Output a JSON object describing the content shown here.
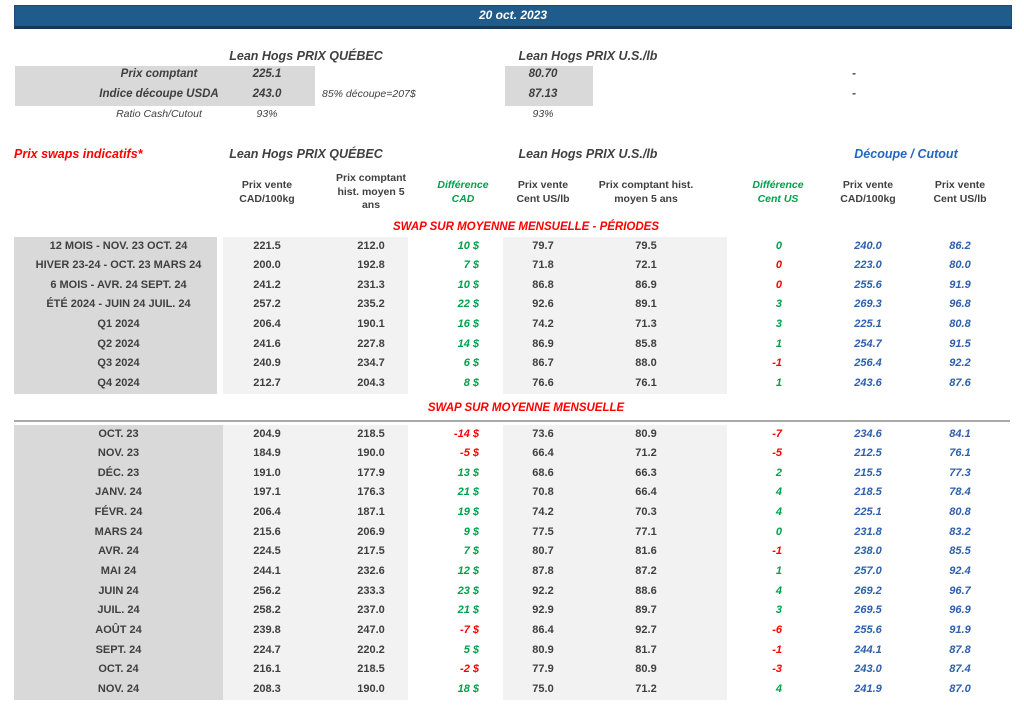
{
  "banner": {
    "date": "20 oct. 2023"
  },
  "colors": {
    "banner_bg": "#1F5C8C",
    "green": "#00A14B",
    "red": "#FF0000",
    "blue_values": "#2E5FAC",
    "label_bg": "#D9D9D9",
    "value_bg": "#F2F2F2"
  },
  "spot": {
    "qc_title": "Lean Hogs PRIX QUÉBEC",
    "us_title": "Lean Hogs PRIX U.S./lb",
    "rows": [
      {
        "label": "Prix comptant",
        "qc": "225.1",
        "note": "",
        "us": "80.70",
        "dash": "-"
      },
      {
        "label": "Indice découpe USDA",
        "qc": "243.0",
        "note": "85% découpe=207$",
        "us": "87.13",
        "dash": "-"
      },
      {
        "label": "Ratio Cash/Cutout",
        "qc": "93%",
        "note": "",
        "us": "93%",
        "dash": ""
      }
    ]
  },
  "swaps": {
    "title": "Prix swaps indicatifs*",
    "qc_title": "Lean Hogs PRIX QUÉBEC",
    "us_title": "Lean Hogs PRIX U.S./lb",
    "cutout_title": "Découpe / Cutout",
    "col_headers": {
      "c2": "Prix vente\nCAD/100kg",
      "c3": "Prix comptant\nhist. moyen 5\nans",
      "c4": "Différence\nCAD",
      "c5": "Prix vente\nCent US/lb",
      "c6": "Prix comptant hist.\nmoyen 5 ans",
      "c7": "Différence\nCent US",
      "c8": "Prix vente\nCAD/100kg",
      "c9": "Prix vente\nCent US/lb"
    },
    "sections": [
      {
        "header": "SWAP SUR MOYENNE MENSUELLE - PÉRIODES",
        "rows": [
          {
            "label": "12 MOIS - NOV. 23 OCT. 24",
            "c2": "221.5",
            "c3": "212.0",
            "c4": "10 $",
            "c4s": "pos",
            "c5": "79.7",
            "c6": "79.5",
            "c7": "0",
            "c7s": "pos",
            "c8": "240.0",
            "c9": "86.2"
          },
          {
            "label": "HIVER 23-24 -  OCT. 23 MARS 24",
            "c2": "200.0",
            "c3": "192.8",
            "c4": "7 $",
            "c4s": "pos",
            "c5": "71.8",
            "c6": "72.1",
            "c7": "0",
            "c7s": "neg",
            "c8": "223.0",
            "c9": "80.0"
          },
          {
            "label": "6 MOIS -  AVR. 24 SEPT. 24",
            "c2": "241.2",
            "c3": "231.3",
            "c4": "10 $",
            "c4s": "pos",
            "c5": "86.8",
            "c6": "86.9",
            "c7": "0",
            "c7s": "neg",
            "c8": "255.6",
            "c9": "91.9"
          },
          {
            "label": "ÉTÉ 2024 - JUIN 24 JUIL. 24",
            "c2": "257.2",
            "c3": "235.2",
            "c4": "22 $",
            "c4s": "pos",
            "c5": "92.6",
            "c6": "89.1",
            "c7": "3",
            "c7s": "pos",
            "c8": "269.3",
            "c9": "96.8"
          },
          {
            "label": "Q1 2024",
            "c2": "206.4",
            "c3": "190.1",
            "c4": "16 $",
            "c4s": "pos",
            "c5": "74.2",
            "c6": "71.3",
            "c7": "3",
            "c7s": "pos",
            "c8": "225.1",
            "c9": "80.8"
          },
          {
            "label": "Q2 2024",
            "c2": "241.6",
            "c3": "227.8",
            "c4": "14 $",
            "c4s": "pos",
            "c5": "86.9",
            "c6": "85.8",
            "c7": "1",
            "c7s": "pos",
            "c8": "254.7",
            "c9": "91.5"
          },
          {
            "label": "Q3 2024",
            "c2": "240.9",
            "c3": "234.7",
            "c4": "6 $",
            "c4s": "pos",
            "c5": "86.7",
            "c6": "88.0",
            "c7": "-1",
            "c7s": "neg",
            "c8": "256.4",
            "c9": "92.2"
          },
          {
            "label": "Q4 2024",
            "c2": "212.7",
            "c3": "204.3",
            "c4": "8 $",
            "c4s": "pos",
            "c5": "76.6",
            "c6": "76.1",
            "c7": "1",
            "c7s": "pos",
            "c8": "243.6",
            "c9": "87.6"
          }
        ]
      },
      {
        "header": "SWAP SUR MOYENNE MENSUELLE",
        "rows": [
          {
            "label": "OCT. 23",
            "c2": "204.9",
            "c3": "218.5",
            "c4": "-14 $",
            "c4s": "neg",
            "c5": "73.6",
            "c6": "80.9",
            "c7": "-7",
            "c7s": "neg",
            "c8": "234.6",
            "c9": "84.1"
          },
          {
            "label": "NOV. 23",
            "c2": "184.9",
            "c3": "190.0",
            "c4": "-5 $",
            "c4s": "neg",
            "c5": "66.4",
            "c6": "71.2",
            "c7": "-5",
            "c7s": "neg",
            "c8": "212.5",
            "c9": "76.1"
          },
          {
            "label": "DÉC. 23",
            "c2": "191.0",
            "c3": "177.9",
            "c4": "13 $",
            "c4s": "pos",
            "c5": "68.6",
            "c6": "66.3",
            "c7": "2",
            "c7s": "pos",
            "c8": "215.5",
            "c9": "77.3"
          },
          {
            "label": "JANV. 24",
            "c2": "197.1",
            "c3": "176.3",
            "c4": "21 $",
            "c4s": "pos",
            "c5": "70.8",
            "c6": "66.4",
            "c7": "4",
            "c7s": "pos",
            "c8": "218.5",
            "c9": "78.4"
          },
          {
            "label": "FÉVR. 24",
            "c2": "206.4",
            "c3": "187.1",
            "c4": "19 $",
            "c4s": "pos",
            "c5": "74.2",
            "c6": "70.3",
            "c7": "4",
            "c7s": "pos",
            "c8": "225.1",
            "c9": "80.8"
          },
          {
            "label": "MARS 24",
            "c2": "215.6",
            "c3": "206.9",
            "c4": "9 $",
            "c4s": "pos",
            "c5": "77.5",
            "c6": "77.1",
            "c7": "0",
            "c7s": "pos",
            "c8": "231.8",
            "c9": "83.2"
          },
          {
            "label": "AVR. 24",
            "c2": "224.5",
            "c3": "217.5",
            "c4": "7 $",
            "c4s": "pos",
            "c5": "80.7",
            "c6": "81.6",
            "c7": "-1",
            "c7s": "neg",
            "c8": "238.0",
            "c9": "85.5"
          },
          {
            "label": "MAI 24",
            "c2": "244.1",
            "c3": "232.6",
            "c4": "12 $",
            "c4s": "pos",
            "c5": "87.8",
            "c6": "87.2",
            "c7": "1",
            "c7s": "pos",
            "c8": "257.0",
            "c9": "92.4"
          },
          {
            "label": "JUIN 24",
            "c2": "256.2",
            "c3": "233.3",
            "c4": "23 $",
            "c4s": "pos",
            "c5": "92.2",
            "c6": "88.6",
            "c7": "4",
            "c7s": "pos",
            "c8": "269.2",
            "c9": "96.7"
          },
          {
            "label": "JUIL. 24",
            "c2": "258.2",
            "c3": "237.0",
            "c4": "21 $",
            "c4s": "pos",
            "c5": "92.9",
            "c6": "89.7",
            "c7": "3",
            "c7s": "pos",
            "c8": "269.5",
            "c9": "96.9"
          },
          {
            "label": "AOÛT 24",
            "c2": "239.8",
            "c3": "247.0",
            "c4": "-7 $",
            "c4s": "neg",
            "c5": "86.4",
            "c6": "92.7",
            "c7": "-6",
            "c7s": "neg",
            "c8": "255.6",
            "c9": "91.9"
          },
          {
            "label": "SEPT. 24",
            "c2": "224.7",
            "c3": "220.2",
            "c4": "5 $",
            "c4s": "pos",
            "c5": "80.9",
            "c6": "81.7",
            "c7": "-1",
            "c7s": "neg",
            "c8": "244.1",
            "c9": "87.8"
          },
          {
            "label": "OCT. 24",
            "c2": "216.1",
            "c3": "218.5",
            "c4": "-2 $",
            "c4s": "neg",
            "c5": "77.9",
            "c6": "80.9",
            "c7": "-3",
            "c7s": "neg",
            "c8": "243.0",
            "c9": "87.4"
          },
          {
            "label": "NOV. 24",
            "c2": "208.3",
            "c3": "190.0",
            "c4": "18 $",
            "c4s": "pos",
            "c5": "75.0",
            "c6": "71.2",
            "c7": "4",
            "c7s": "pos",
            "c8": "241.9",
            "c9": "87.0"
          }
        ]
      }
    ]
  }
}
